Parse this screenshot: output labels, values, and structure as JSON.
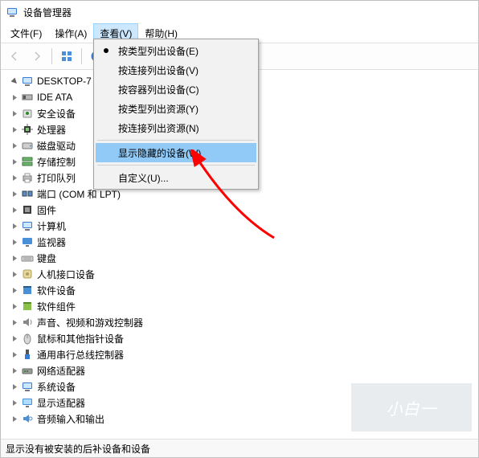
{
  "window": {
    "title": "设备管理器"
  },
  "menubar": {
    "items": [
      {
        "label": "文件(F)"
      },
      {
        "label": "操作(A)"
      },
      {
        "label": "查看(V)",
        "selected": true
      },
      {
        "label": "帮助(H)"
      }
    ]
  },
  "dropdown": {
    "items": [
      {
        "label": "按类型列出设备(E)",
        "bullet": true
      },
      {
        "label": "按连接列出设备(V)"
      },
      {
        "label": "按容器列出设备(C)"
      },
      {
        "label": "按类型列出资源(Y)"
      },
      {
        "label": "按连接列出资源(N)"
      },
      {
        "sep": true
      },
      {
        "label": "显示隐藏的设备(W)",
        "highlight": true
      },
      {
        "sep": true
      },
      {
        "label": "自定义(U)..."
      }
    ]
  },
  "tree": {
    "root": {
      "label": "DESKTOP-7",
      "icon": "computer"
    },
    "children": [
      {
        "label": "IDE ATA",
        "icon": "ide"
      },
      {
        "label": "安全设备",
        "icon": "security"
      },
      {
        "label": "处理器",
        "icon": "cpu"
      },
      {
        "label": "磁盘驱动",
        "icon": "disk"
      },
      {
        "label": "存储控制",
        "icon": "storage"
      },
      {
        "label": "打印队列",
        "icon": "printer"
      },
      {
        "label": "端口 (COM 和 LPT)",
        "icon": "port"
      },
      {
        "label": "固件",
        "icon": "firmware"
      },
      {
        "label": "计算机",
        "icon": "computer"
      },
      {
        "label": "监视器",
        "icon": "monitor"
      },
      {
        "label": "键盘",
        "icon": "keyboard"
      },
      {
        "label": "人机接口设备",
        "icon": "hid"
      },
      {
        "label": "软件设备",
        "icon": "software"
      },
      {
        "label": "软件组件",
        "icon": "component"
      },
      {
        "label": "声音、视频和游戏控制器",
        "icon": "audio"
      },
      {
        "label": "鼠标和其他指针设备",
        "icon": "mouse"
      },
      {
        "label": "通用串行总线控制器",
        "icon": "usb"
      },
      {
        "label": "网络适配器",
        "icon": "network"
      },
      {
        "label": "系统设备",
        "icon": "system"
      },
      {
        "label": "显示适配器",
        "icon": "display"
      },
      {
        "label": "音频输入和输出",
        "icon": "audioio"
      }
    ]
  },
  "statusbar": {
    "text": "显示没有被安装的后补设备和设备"
  },
  "watermark": {
    "text": "小白一"
  }
}
